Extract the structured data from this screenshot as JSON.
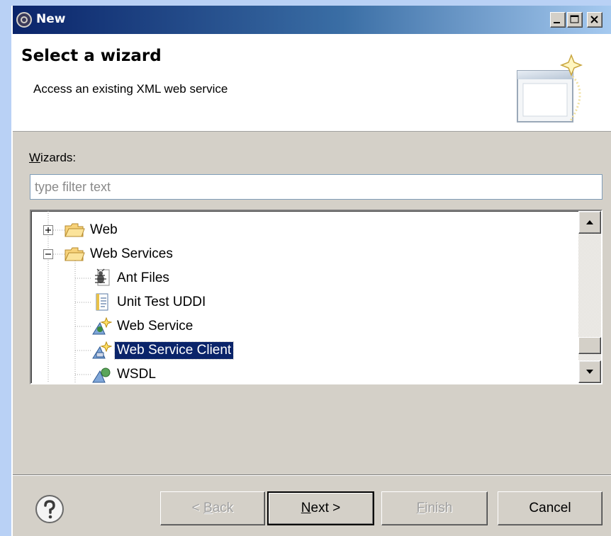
{
  "window": {
    "title": "New"
  },
  "header": {
    "title": "Select a wizard",
    "description": "Access an existing XML web service"
  },
  "wizards": {
    "label_mnemonic": "W",
    "label_rest": "izards:",
    "filter_placeholder": "type filter text",
    "tree": [
      {
        "label": "Web",
        "icon": "folder-icon",
        "expanded": false,
        "level": 0
      },
      {
        "label": "Web Services",
        "icon": "folder-icon",
        "expanded": true,
        "level": 0
      },
      {
        "label": "Ant Files",
        "icon": "ant-icon",
        "level": 1
      },
      {
        "label": "Unit Test UDDI",
        "icon": "document-icon",
        "level": 1
      },
      {
        "label": "Web Service",
        "icon": "web-service-icon",
        "level": 1
      },
      {
        "label": "Web Service Client",
        "icon": "web-service-client-icon",
        "level": 1,
        "selected": true
      },
      {
        "label": "WSDL",
        "icon": "wsdl-icon",
        "level": 1
      }
    ]
  },
  "buttons": {
    "back_prefix": "< ",
    "back_mnemonic": "B",
    "back_rest": "ack",
    "next_mnemonic": "N",
    "next_rest": "ext >",
    "finish_mnemonic": "F",
    "finish_rest": "inish",
    "cancel": "Cancel"
  },
  "colors": {
    "titlebar_start": "#0a246a",
    "selection": "#0a246a",
    "dialog_bg": "#d4d0c8"
  }
}
